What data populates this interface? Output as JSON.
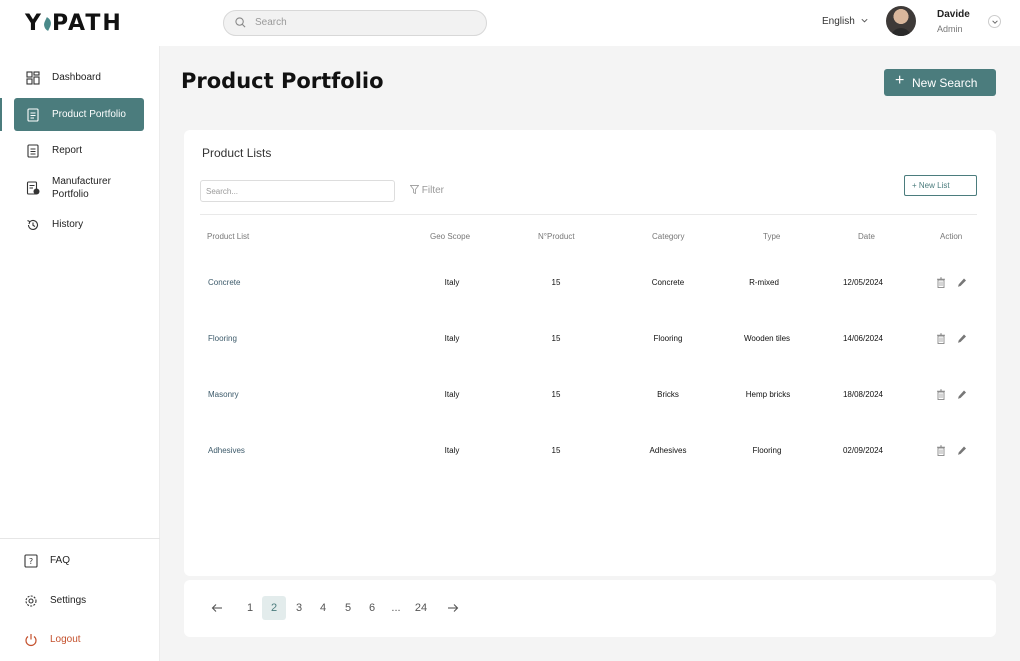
{
  "header": {
    "logo": "YPATH",
    "search_placeholder": "Search",
    "language": "English",
    "user_name": "Davide",
    "user_role": "Admin"
  },
  "sidebar": {
    "items": [
      {
        "label": "Dashboard",
        "icon": "dashboard-icon"
      },
      {
        "label": "Product Portfolio",
        "icon": "document-icon",
        "active": true
      },
      {
        "label": "Report",
        "icon": "report-icon"
      },
      {
        "label": "Manufacturer Portfolio",
        "icon": "manufacturer-doc-icon"
      },
      {
        "label": "History",
        "icon": "history-icon"
      }
    ],
    "bottom": [
      {
        "label": "FAQ",
        "icon": "faq-icon"
      },
      {
        "label": "Settings",
        "icon": "gear-icon"
      },
      {
        "label": "Logout",
        "icon": "power-icon"
      }
    ]
  },
  "main": {
    "title": "Product Portfolio",
    "new_search_label": "New Search",
    "card_title": "Product Lists",
    "list_search_placeholder": "Search...",
    "filter_label": "Filter",
    "new_list_label": "+ New List",
    "columns": [
      "Product List",
      "Geo Scope",
      "N°Product",
      "Category",
      "Type",
      "Date",
      "Action"
    ],
    "rows": [
      {
        "name": "Concrete",
        "geo": "Italy",
        "count": "15",
        "category": "Concrete",
        "type": "R-mixed",
        "date": "12/05/2024"
      },
      {
        "name": "Flooring",
        "geo": "Italy",
        "count": "15",
        "category": "Flooring",
        "type": "Wooden tiles",
        "date": "14/06/2024"
      },
      {
        "name": "Masonry",
        "geo": "Italy",
        "count": "15",
        "category": "Bricks",
        "type": "Hemp bricks",
        "date": "18/08/2024"
      },
      {
        "name": "Adhesives",
        "geo": "Italy",
        "count": "15",
        "category": "Adhesives",
        "type": "Flooring",
        "date": "02/09/2024"
      }
    ]
  },
  "pagination": {
    "pages": [
      "1",
      "2",
      "3",
      "4",
      "5",
      "6",
      "...",
      "24"
    ],
    "current": "2"
  },
  "colors": {
    "accent": "#4b7c7d",
    "logout": "#c4512d"
  }
}
